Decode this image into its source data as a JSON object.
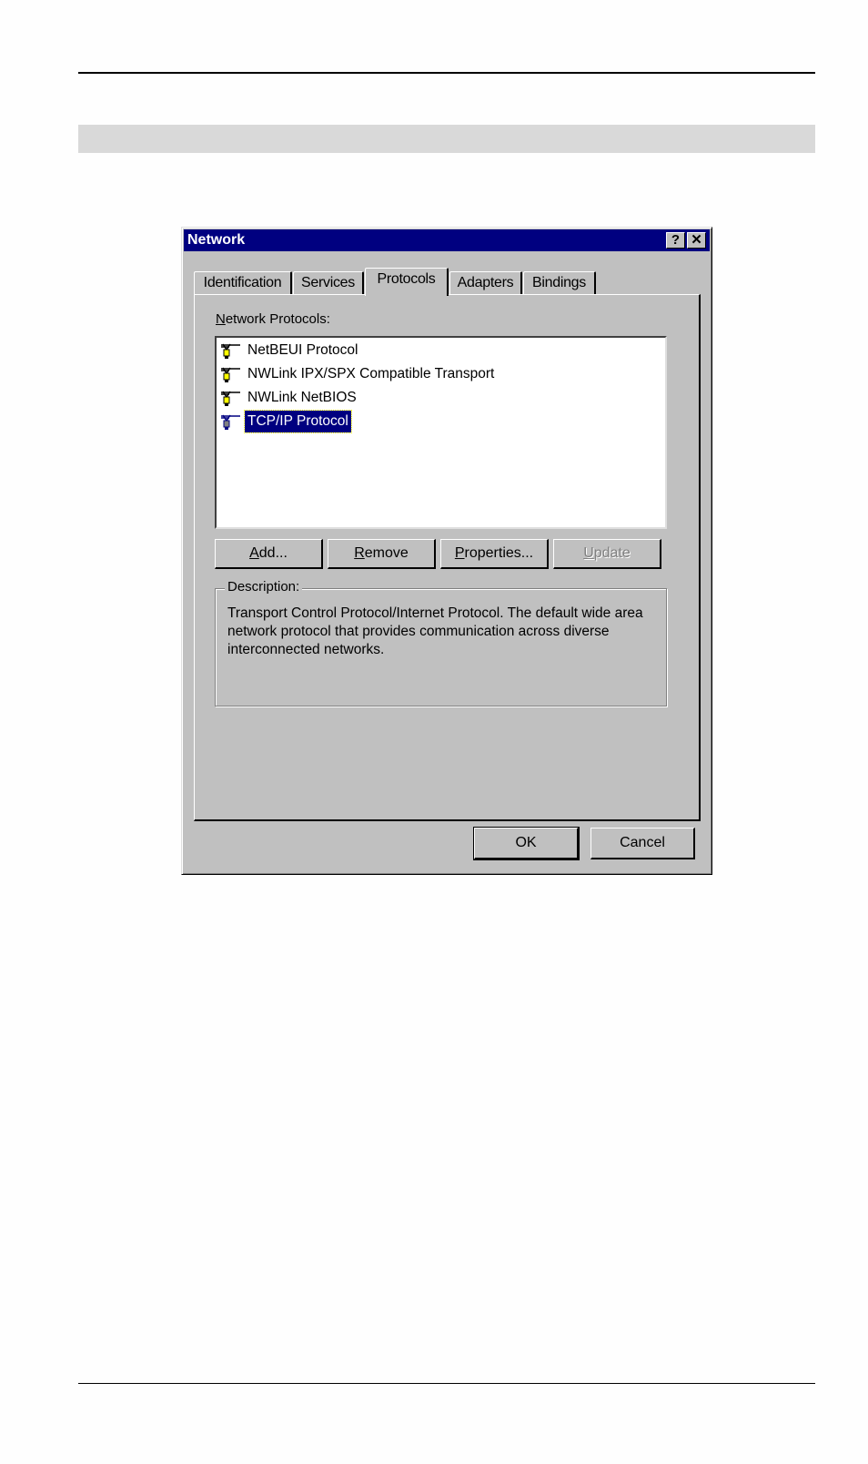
{
  "dialog": {
    "title": "Network",
    "help_button": "?",
    "close_button": "✕",
    "tabs": [
      {
        "label": "Identification",
        "active": false
      },
      {
        "label": "Services",
        "active": false
      },
      {
        "label": "Protocols",
        "active": true
      },
      {
        "label": "Adapters",
        "active": false
      },
      {
        "label": "Bindings",
        "active": false
      }
    ],
    "protocols_label_accel": "N",
    "protocols_label_rest": "etwork Protocols:",
    "protocols": [
      {
        "label": "NetBEUI Protocol",
        "icon": "network-protocol-icon",
        "selected": false
      },
      {
        "label": "NWLink IPX/SPX Compatible Transport",
        "icon": "network-protocol-icon",
        "selected": false
      },
      {
        "label": "NWLink NetBIOS",
        "icon": "network-protocol-icon",
        "selected": false
      },
      {
        "label": "TCP/IP Protocol",
        "icon": "network-protocol-icon",
        "selected": true
      }
    ],
    "buttons": {
      "add_accel": "A",
      "add_rest": "dd...",
      "remove_accel": "R",
      "remove_rest": "emove",
      "properties_accel": "P",
      "properties_rest": "roperties...",
      "update_accel": "U",
      "update_rest": "pdate",
      "update_disabled": true
    },
    "description_title": "Description:",
    "description_text": "Transport Control Protocol/Internet Protocol. The default wide area network protocol that provides communication across diverse interconnected networks.",
    "ok": "OK",
    "cancel": "Cancel"
  },
  "colors": {
    "titlebar": "#000080",
    "face": "#c0c0c0",
    "selection": "#000080",
    "band": "#d9d9d9"
  }
}
